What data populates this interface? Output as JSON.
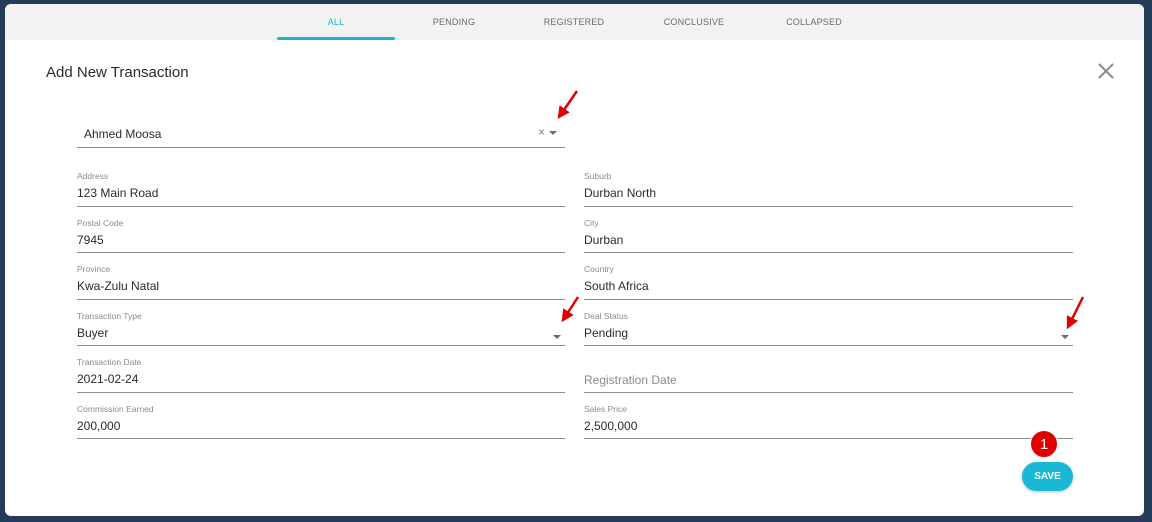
{
  "tabs": [
    {
      "label": "ALL",
      "active": true
    },
    {
      "label": "PENDING",
      "active": false
    },
    {
      "label": "REGISTERED",
      "active": false
    },
    {
      "label": "CONCLUSIVE",
      "active": false
    },
    {
      "label": "COLLAPSED",
      "active": false
    }
  ],
  "dialog": {
    "title": "Add New Transaction",
    "close_icon": "close-icon"
  },
  "client_select": {
    "value": "Ahmed Moosa",
    "clear_glyph": "×"
  },
  "fields": {
    "address": {
      "label": "Address",
      "value": "123 Main Road"
    },
    "suburb": {
      "label": "Suburb",
      "value": "Durban North"
    },
    "postal_code": {
      "label": "Postal Code",
      "value": "7945"
    },
    "city": {
      "label": "City",
      "value": "Durban"
    },
    "province": {
      "label": "Province",
      "value": "Kwa-Zulu Natal"
    },
    "country": {
      "label": "Country",
      "value": "South Africa"
    },
    "transaction_type": {
      "label": "Transaction Type",
      "value": "Buyer"
    },
    "deal_status": {
      "label": "Deal Status",
      "value": "Pending"
    },
    "transaction_date": {
      "label": "Transaction Date",
      "value": "2021-02-24"
    },
    "registration_date": {
      "placeholder": "Registration Date"
    },
    "commission_earned": {
      "label": "Commission Earned",
      "value": "200,000"
    },
    "sales_price": {
      "label": "Sales Price",
      "value": "2,500,000"
    }
  },
  "save_label": "SAVE",
  "annotation_badge": "1",
  "colors": {
    "accent": "#19b4d4",
    "annotation": "#e00000",
    "frame_bg": "#243b5a"
  }
}
